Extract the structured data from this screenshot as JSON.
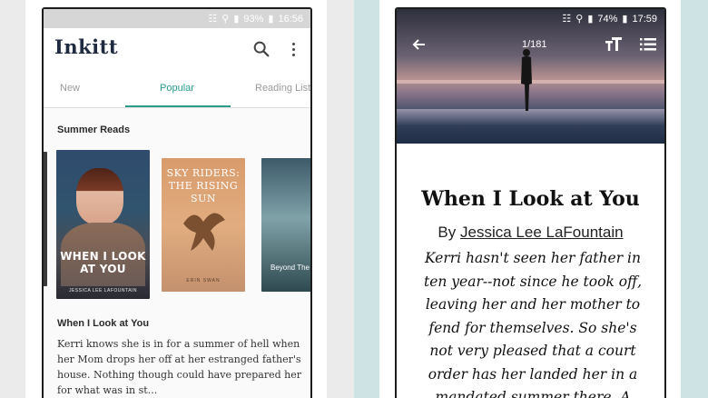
{
  "left_phone": {
    "status": {
      "battery": "93%",
      "time": "16:56"
    },
    "app_name": "Inkitt",
    "tabs": [
      {
        "label": "New"
      },
      {
        "label": "Popular",
        "active": true
      },
      {
        "label": "Reading Lists"
      }
    ],
    "section_title": "Summer Reads",
    "books": [
      {
        "title": "WHEN I LOOK AT YOU",
        "author": "JESSICA LEE LAFOUNTAIN"
      },
      {
        "title": "SKY RIDERS: THE RISING SUN",
        "author": "ERIN SWAN"
      },
      {
        "title": "Beyond The Wate"
      }
    ],
    "story": {
      "title": "When I Look at You",
      "description": "Kerri  knows she is in for a summer of hell when her Mom drops her off at her estranged father's house. Nothing though could have prepared her for what was in st..."
    },
    "accent_color": "#2a9c8c"
  },
  "right_phone": {
    "status": {
      "battery": "74%",
      "time": "17:59"
    },
    "page_indicator": "1/181",
    "book_title": "When I Look at You",
    "by_prefix": "By",
    "author": "Jessica Lee LaFountain",
    "description": "Kerri hasn't seen her father in ten year--not since he took off, leaving her and her mother to fend for themselves. So she's not very pleased that a court order has her landed her in a mandated summer there. A"
  }
}
